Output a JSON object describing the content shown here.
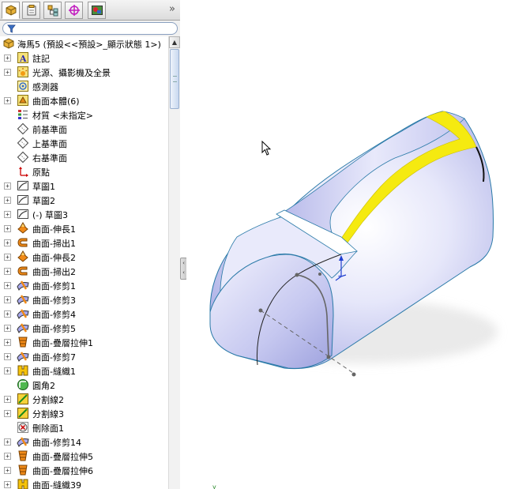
{
  "tabs": [
    {
      "name": "feature-manager",
      "icon": "feature-tree-icon",
      "active": true
    },
    {
      "name": "property-manager",
      "icon": "property-manager-icon",
      "active": false
    },
    {
      "name": "configuration-manager",
      "icon": "configuration-manager-icon",
      "active": false
    },
    {
      "name": "dimxpert-manager",
      "icon": "dimxpert-icon",
      "active": false
    },
    {
      "name": "display-manager",
      "icon": "display-manager-icon",
      "active": false
    }
  ],
  "tab_more": "»",
  "filter": {
    "icon": "filter-icon",
    "value": ""
  },
  "tree": {
    "root": {
      "label": "海馬5 (預設<<預設>_顯示狀態 1>)",
      "icon": "part-icon"
    },
    "items": [
      {
        "label": "註記",
        "icon": "annotations-icon",
        "expandable": true
      },
      {
        "label": "光源、攝影機及全景",
        "icon": "lights-cameras-icon",
        "expandable": true
      },
      {
        "label": "感測器",
        "icon": "sensors-icon",
        "expandable": false
      },
      {
        "label": "曲面本體(6)",
        "icon": "surface-bodies-icon",
        "expandable": true
      },
      {
        "label": "材質 <未指定>",
        "icon": "material-icon",
        "expandable": false
      },
      {
        "label": "前基準面",
        "icon": "plane-icon",
        "expandable": false
      },
      {
        "label": "上基準面",
        "icon": "plane-icon",
        "expandable": false
      },
      {
        "label": "右基準面",
        "icon": "plane-icon",
        "expandable": false
      },
      {
        "label": "原點",
        "icon": "origin-icon",
        "expandable": false
      },
      {
        "label": "草圖1",
        "icon": "sketch-icon",
        "expandable": true
      },
      {
        "label": "草圖2",
        "icon": "sketch-icon",
        "expandable": true
      },
      {
        "label": "(-) 草圖3",
        "icon": "sketch-icon",
        "expandable": true
      },
      {
        "label": "曲面-伸長1",
        "icon": "surface-extrude-icon",
        "expandable": true
      },
      {
        "label": "曲面-掃出1",
        "icon": "surface-sweep-icon",
        "expandable": true
      },
      {
        "label": "曲面-伸長2",
        "icon": "surface-extrude-icon",
        "expandable": true
      },
      {
        "label": "曲面-掃出2",
        "icon": "surface-sweep-icon",
        "expandable": true
      },
      {
        "label": "曲面-修剪1",
        "icon": "surface-trim-icon",
        "expandable": true
      },
      {
        "label": "曲面-修剪3",
        "icon": "surface-trim-icon",
        "expandable": true
      },
      {
        "label": "曲面-修剪4",
        "icon": "surface-trim-icon",
        "expandable": true
      },
      {
        "label": "曲面-修剪5",
        "icon": "surface-trim-icon",
        "expandable": true
      },
      {
        "label": "曲面-疊層拉伸1",
        "icon": "surface-loft-icon",
        "expandable": true
      },
      {
        "label": "曲面-修剪7",
        "icon": "surface-trim-icon",
        "expandable": true
      },
      {
        "label": "曲面-縫織1",
        "icon": "surface-knit-icon",
        "expandable": true
      },
      {
        "label": "圓角2",
        "icon": "fillet-icon",
        "expandable": false
      },
      {
        "label": "分割線2",
        "icon": "split-line-icon",
        "expandable": true
      },
      {
        "label": "分割線3",
        "icon": "split-line-icon",
        "expandable": true
      },
      {
        "label": "刪除面1",
        "icon": "delete-face-icon",
        "expandable": false
      },
      {
        "label": "曲面-修剪14",
        "icon": "surface-trim-icon",
        "expandable": true
      },
      {
        "label": "曲面-疊層拉伸5",
        "icon": "surface-loft-icon",
        "expandable": true
      },
      {
        "label": "曲面-疊層拉伸6",
        "icon": "surface-loft-icon",
        "expandable": true
      },
      {
        "label": "曲面-縫織39",
        "icon": "surface-knit-icon",
        "expandable": true
      }
    ]
  },
  "colors": {
    "model_surface": "#c9cbf2",
    "model_highlight": "#ffffff",
    "edge": "#2a7aa8",
    "selected_face": "#f5ea10",
    "sketch": "#333333",
    "triad": "#1f3fd0"
  }
}
